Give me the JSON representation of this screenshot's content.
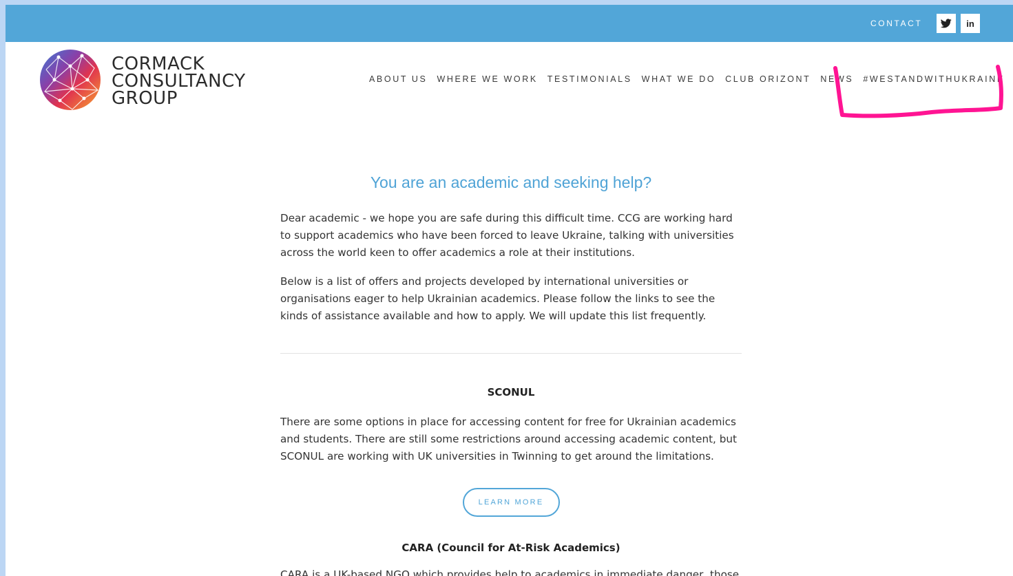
{
  "topbar": {
    "contact_label": "CONTACT",
    "twitter_icon": "twitter-icon",
    "linkedin_label": "in"
  },
  "logo": {
    "line1": "CORMACK",
    "line2": "CONSULTANCY",
    "line3": "GROUP"
  },
  "nav": {
    "items": [
      "ABOUT US",
      "WHERE WE WORK",
      "TESTIMONIALS",
      "WHAT WE DO",
      "CLUB ORIZONT",
      "NEWS",
      "#WESTANDWITHUKRAINE"
    ]
  },
  "main": {
    "title": "You are an academic and seeking help?",
    "intro_1": "Dear academic - we hope you are safe during this difficult time. CCG are working hard to support academics who have been forced to leave Ukraine, talking with universities across the world keen to offer academics a role at their institutions.",
    "intro_2": "Below is a list of offers and projects developed by international universities or organisations eager to help Ukrainian academics. Please follow the links to see the kinds of assistance available and how to apply. We will update this list frequently.",
    "sections": [
      {
        "title": "SCONUL",
        "description": "There are some options in place for accessing content for free for Ukrainian academics and students. There are still some restrictions around accessing academic content, but SCONUL are working with UK universities in Twinning to get around the limitations.",
        "button": "LEARN MORE"
      },
      {
        "title": "CARA (Council for At-Risk Academics)",
        "description": "CARA is a UK-based NGO which provides help to academics in immediate danger, those"
      }
    ]
  },
  "colors": {
    "topbar": "#52a6d8",
    "accent": "#4fa3d6",
    "annotation": "#ff1493"
  }
}
